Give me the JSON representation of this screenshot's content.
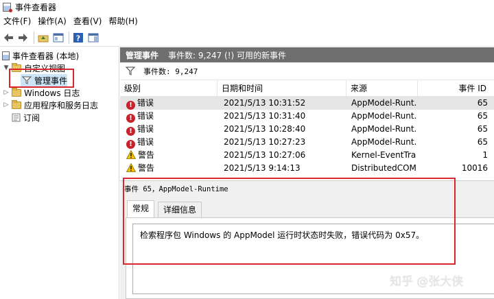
{
  "window": {
    "title": "事件查看器"
  },
  "menu": [
    "文件(F)",
    "操作(A)",
    "查看(V)",
    "帮助(H)"
  ],
  "toolbar": {
    "icons": [
      "back-arrow-icon",
      "forward-arrow-icon",
      "folder-up-icon",
      "console-tree-icon",
      "help-icon",
      "action-pane-icon"
    ]
  },
  "tree": {
    "root": "事件查看器 (本地)",
    "custom_views": "自定义视图",
    "admin_events": "管理事件",
    "windows_logs": "Windows 日志",
    "app_service_logs": "应用程序和服务日志",
    "subscriptions": "订阅"
  },
  "pane": {
    "title": "管理事件",
    "summary": "事件数: 9,247 (!) 可用的新事件",
    "filter_text": "事件数: 9,247"
  },
  "grid": {
    "columns": [
      "级别",
      "日期和时间",
      "来源",
      "事件 ID"
    ],
    "rows": [
      {
        "level": "错误",
        "type": "error",
        "time": "2021/5/13 10:31:52",
        "source": "AppModel-Runt...",
        "id": "65"
      },
      {
        "level": "错误",
        "type": "error",
        "time": "2021/5/13 10:31:40",
        "source": "AppModel-Runt...",
        "id": "65"
      },
      {
        "level": "错误",
        "type": "error",
        "time": "2021/5/13 10:28:40",
        "source": "AppModel-Runt...",
        "id": "65"
      },
      {
        "level": "错误",
        "type": "error",
        "time": "2021/5/13 10:27:23",
        "source": "AppModel-Runt...",
        "id": "65"
      },
      {
        "level": "警告",
        "type": "warning",
        "time": "2021/5/13 10:27:06",
        "source": "Kernel-EventTra...",
        "id": "1"
      },
      {
        "level": "警告",
        "type": "warning",
        "time": "2021/5/13 9:14:13",
        "source": "DistributedCOM",
        "id": "10016"
      }
    ]
  },
  "detail": {
    "header": "事件 65，AppModel-Runtime",
    "tabs": [
      "常规",
      "详细信息"
    ],
    "message": "检索程序包 Windows 的 AppModel 运行时状态时失败，错误代码为 0x57。"
  },
  "watermark": "知乎 @张大侠",
  "colors": {
    "header_bg": "#6e6e6e",
    "selection": "#cce4f7",
    "highlight_box": "#d9262c",
    "error": "#c8232c",
    "warning": "#f2c200"
  }
}
